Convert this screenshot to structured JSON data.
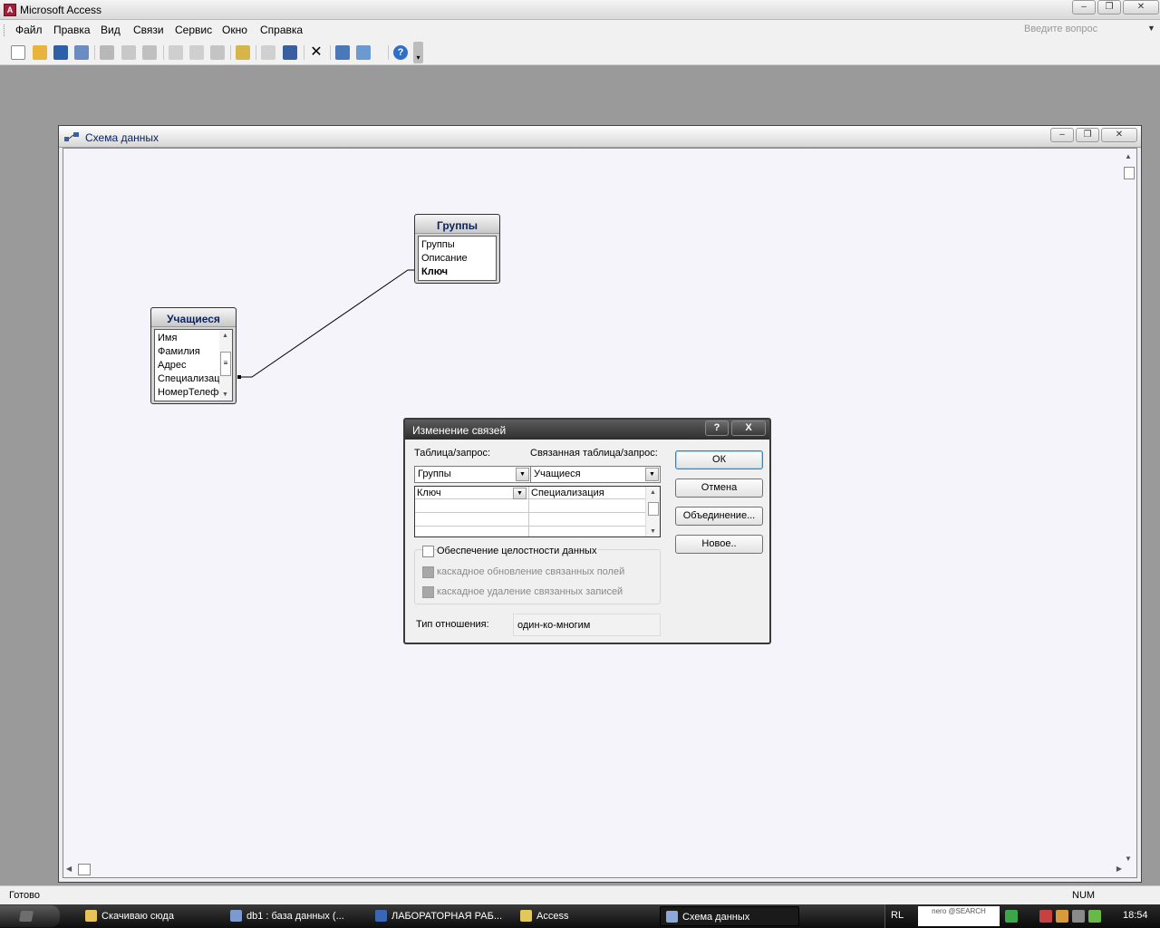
{
  "app": {
    "title": "Microsoft Access",
    "icon": "access-key-icon"
  },
  "menu": {
    "items": [
      "Файл",
      "Правка",
      "Вид",
      "Связи",
      "Сервис",
      "Окно",
      "Справка"
    ],
    "help_search_placeholder": "Введите вопрос"
  },
  "toolbar": {
    "icons": [
      "new-icon",
      "open-icon",
      "save-icon",
      "search-icon",
      "print-icon",
      "print-preview-icon",
      "spelling-icon",
      "cut-icon",
      "copy-icon",
      "paste-icon",
      "show-table-icon",
      "show-direct-icon",
      "show-all-icon",
      "delete-icon",
      "new-object-icon",
      "new-object-dropdown-icon",
      "help-icon"
    ]
  },
  "relationships_window": {
    "title": "Схема данных",
    "tables": [
      {
        "name": "Группы",
        "fields": [
          {
            "name": "Группы",
            "is_key": false
          },
          {
            "name": "Описание",
            "is_key": false
          },
          {
            "name": "Ключ",
            "is_key": true
          }
        ]
      },
      {
        "name": "Учащиеся",
        "fields": [
          {
            "name": "Имя",
            "is_key": false
          },
          {
            "name": "Фамилия",
            "is_key": false
          },
          {
            "name": "Адрес",
            "is_key": false
          },
          {
            "name": "Специализац",
            "is_key": false
          },
          {
            "name": "НомерТелефо",
            "is_key": false
          }
        ]
      }
    ]
  },
  "dialog": {
    "title": "Изменение связей",
    "help_label": "?",
    "close_label": "X",
    "table_label": "Таблица/запрос:",
    "related_label": "Связанная таблица/запрос:",
    "table_value": "Группы",
    "related_value": "Учащиеся",
    "field_rows": [
      {
        "left": "Ключ",
        "right": "Специализация"
      },
      {
        "left": "",
        "right": ""
      },
      {
        "left": "",
        "right": ""
      }
    ],
    "buttons": {
      "ok": "ОК",
      "cancel": "Отмена",
      "join": "Объединение...",
      "new": "Новое.."
    },
    "integrity": {
      "label": "Обеспечение целостности данных",
      "checked": false
    },
    "cascade_update": {
      "label": "каскадное обновление связанных полей",
      "enabled": false
    },
    "cascade_delete": {
      "label": "каскадное удаление связанных записей",
      "enabled": false
    },
    "relation_type_label": "Тип отношения:",
    "relation_type_value": "один-ко-многим"
  },
  "statusbar": {
    "left": "Готово",
    "right": "NUM"
  },
  "taskbar": {
    "tasks": [
      {
        "label": "Скачиваю сюда",
        "icon": "folder-icon",
        "active": false
      },
      {
        "label": "db1 : база данных (...",
        "icon": "database-icon",
        "active": false
      },
      {
        "label": "ЛАБОРАТОРНАЯ РАБ...",
        "icon": "word-icon",
        "active": false
      },
      {
        "label": "Access",
        "icon": "access-icon",
        "active": false
      },
      {
        "label": "Схема данных",
        "icon": "relationships-icon",
        "active": true
      }
    ],
    "language": "RL",
    "nero_label": "nero @SEARCH",
    "clock": "18:54"
  },
  "colors": {
    "workspace": "#9a9a9a",
    "canvas": "#f4f4fa",
    "table_title": "#0b2361",
    "dialog_title_bar": "#3a3a3a"
  }
}
